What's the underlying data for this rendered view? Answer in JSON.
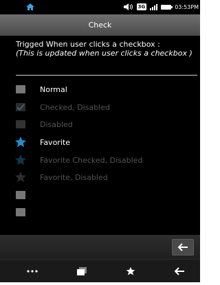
{
  "status_bar": {
    "network_type": "3G",
    "time": "03:53PM",
    "icons": [
      "home-icon",
      "sound-icon",
      "3g-icon",
      "signal-icon",
      "battery-icon"
    ]
  },
  "title_bar": {
    "title": "Check"
  },
  "content": {
    "header_line": "Trigged When user clicks a checkbox :",
    "header_italic": "(This is updated when user clicks a checkbox )",
    "rows": [
      {
        "label": "Normal",
        "type": "checkbox",
        "checked": false,
        "disabled": false
      },
      {
        "label": "Checked, Disabled",
        "type": "checkbox",
        "checked": true,
        "disabled": true
      },
      {
        "label": "Disabled",
        "type": "checkbox",
        "checked": false,
        "disabled": true
      },
      {
        "label": "Favorite",
        "type": "star",
        "checked": true,
        "disabled": false
      },
      {
        "label": "Favorite Checked, Disabled",
        "type": "star",
        "checked": true,
        "disabled": true
      },
      {
        "label": "Favorite, Disabled",
        "type": "star",
        "checked": false,
        "disabled": true
      },
      {
        "label": "",
        "type": "checkbox",
        "checked": false,
        "disabled": false
      },
      {
        "label": "",
        "type": "checkbox",
        "checked": false,
        "disabled": false
      }
    ]
  },
  "bottom_bar": {
    "back_icon": "back-arrow-icon"
  },
  "nav_bar": {
    "items": [
      "more-icon",
      "windows-icon",
      "star-icon",
      "back-icon"
    ]
  },
  "colors": {
    "accent_blue": "#1e8fd6",
    "title_bg": "#5a5a5a",
    "background": "#000000"
  }
}
